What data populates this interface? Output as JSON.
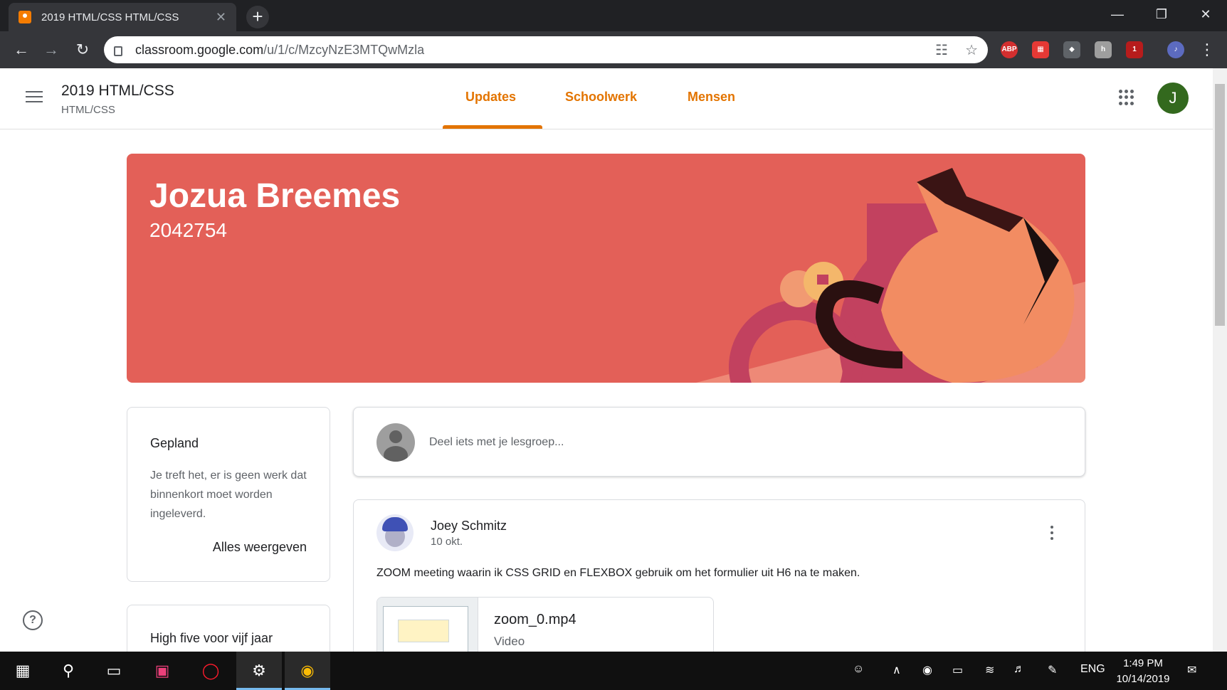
{
  "browser": {
    "tab_title": "2019 HTML/CSS HTML/CSS",
    "tab_close": "✕",
    "new_tab": "+",
    "url_host": "classroom.google.com",
    "url_path": "/u/1/c/MzcyNzE3MTQwMzla",
    "extensions": {
      "abp": "ABP",
      "ublock_badge": "1"
    }
  },
  "app": {
    "class_title": "2019 HTML/CSS",
    "class_subtitle": "HTML/CSS",
    "tabs": [
      {
        "label": "Updates",
        "active": true
      },
      {
        "label": "Schoolwerk",
        "active": false
      },
      {
        "label": "Mensen",
        "active": false
      }
    ],
    "account_initial": "J",
    "accent_color": "#e37400"
  },
  "banner": {
    "title": "Jozua Breemes",
    "section": "2042754",
    "color": "#e36058"
  },
  "upcoming": {
    "title": "Gepland",
    "text": "Je treft het, er is geen werk dat binnenkort moet worden ingeleverd.",
    "link": "Alles weergeven"
  },
  "highfive": {
    "title": "High five voor vijf jaar"
  },
  "share": {
    "placeholder": "Deel iets met je lesgroep..."
  },
  "post": {
    "author": "Joey Schmitz",
    "date": "10 okt.",
    "body": "ZOOM meeting waarin ik CSS GRID en FLEXBOX gebruik om het formulier uit H6 na te maken.",
    "attachment": {
      "name": "zoom_0.mp4",
      "type": "Video"
    }
  },
  "help_label": "?",
  "taskbar": {
    "lang": "ENG",
    "time": "1:49 PM",
    "date": "10/14/2019"
  }
}
